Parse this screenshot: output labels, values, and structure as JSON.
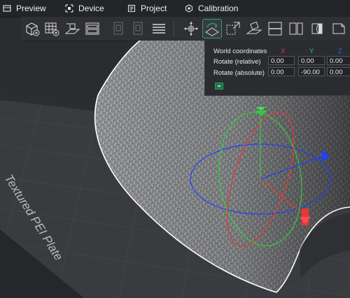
{
  "nav": {
    "items": [
      {
        "label": "Preview",
        "icon": "preview-icon"
      },
      {
        "label": "Device",
        "icon": "device-icon"
      },
      {
        "label": "Project",
        "icon": "project-icon"
      },
      {
        "label": "Calibration",
        "icon": "calibration-icon"
      }
    ]
  },
  "toolbar": {
    "buttons": [
      "add-object-icon",
      "plate-grid-icon",
      "auto-orient-icon",
      "arrange-icon",
      "slice-plate-icon",
      "slice-all-icon",
      "layers-icon",
      "move-icon",
      "rotate-icon",
      "scale-icon",
      "lay-on-face-icon",
      "cut-icon",
      "support-paint-icon",
      "seam-paint-icon",
      "color-paint-icon"
    ],
    "active": "rotate-icon"
  },
  "viewport": {
    "plate_label": "Textured PEI Plate",
    "colors": {
      "x_axis": "#e53935",
      "y_axis": "#2ecc40",
      "z_axis": "#1e40ff"
    }
  },
  "rotate_panel": {
    "header": "World coordinates",
    "axes": {
      "x": "X",
      "y": "Y",
      "z": "Z"
    },
    "axis_colors": {
      "x": "#e53935",
      "y": "#34c759",
      "z": "#2f5bff"
    },
    "rows": [
      {
        "label": "Rotate (relative)",
        "values": [
          "0.00",
          "0.00",
          "0.00"
        ]
      },
      {
        "label": "Rotate (absolute)",
        "values": [
          "0.00",
          "-90.00",
          "0.00"
        ]
      }
    ],
    "apply_icon": "reset-rotation-icon"
  }
}
